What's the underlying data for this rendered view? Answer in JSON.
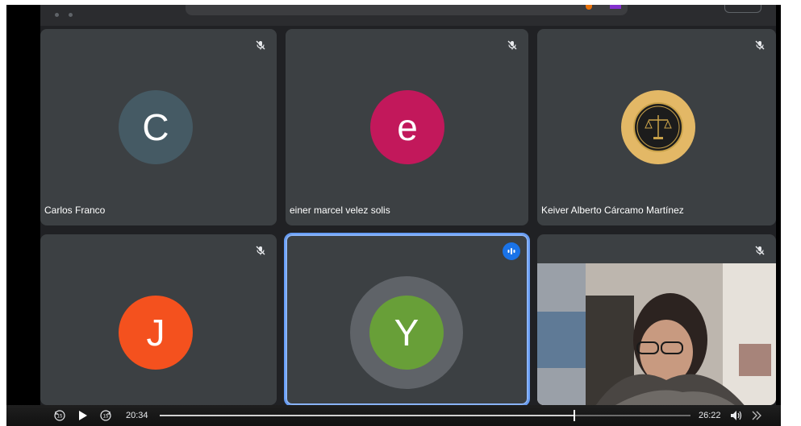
{
  "participants": [
    {
      "name": "Carlos Franco",
      "initial": "C",
      "color": "#455a64",
      "muted": true
    },
    {
      "name": "einer marcel velez solis",
      "initial": "e",
      "color": "#c2185b",
      "muted": true
    },
    {
      "name": "Keiver Alberto Cárcamo Martínez",
      "initial": "",
      "color": "#e3b866",
      "muted": true
    },
    {
      "name": "",
      "initial": "J",
      "color": "#f4511e",
      "muted": true
    },
    {
      "name": "",
      "initial": "Y",
      "color": "#689f38",
      "muted": false,
      "speaking": true
    },
    {
      "name": "",
      "initial": "",
      "color": "",
      "muted": true,
      "camera_on": true
    }
  ],
  "player": {
    "current_time": "20:34",
    "total_time": "26:22",
    "progress": 0.78,
    "icons": [
      "rewind-15-icon",
      "play-icon",
      "forward-15-icon",
      "volume-icon",
      "next-icon"
    ]
  }
}
